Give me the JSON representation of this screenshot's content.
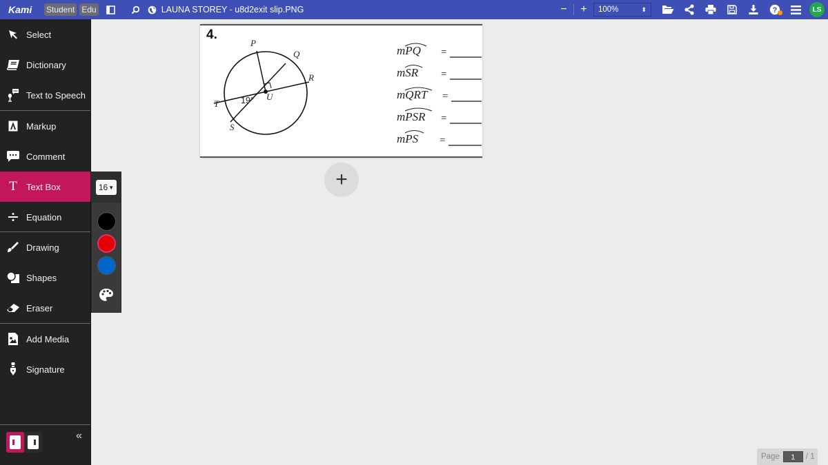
{
  "app": {
    "logo": "Kami",
    "badges": [
      "Student",
      "Edu"
    ],
    "doc_title": "LAUNA STOREY - u8d2exit slip.PNG"
  },
  "toolbar": {
    "zoom_out": "−",
    "zoom_in": "+",
    "zoom_level": "100%",
    "icons": [
      "open-folder-icon",
      "share-icon",
      "print-icon",
      "save-icon",
      "download-icon",
      "help-icon",
      "menu-icon"
    ],
    "user_initials": "LS",
    "notification_dot_color": "#ff9800"
  },
  "sidebar": {
    "items": [
      {
        "label": "Select",
        "icon": "cursor-arrow-icon"
      },
      {
        "label": "Dictionary",
        "icon": "book-icon"
      },
      {
        "label": "Text to Speech",
        "icon": "microphone-speech-icon"
      },
      {
        "label": "Markup",
        "icon": "markup-icon"
      },
      {
        "label": "Comment",
        "icon": "comment-icon"
      },
      {
        "label": "Text Box",
        "icon": "text-t-icon",
        "active": true
      },
      {
        "label": "Equation",
        "icon": "divide-icon"
      },
      {
        "label": "Drawing",
        "icon": "brush-icon"
      },
      {
        "label": "Shapes",
        "icon": "shapes-icon"
      },
      {
        "label": "Eraser",
        "icon": "eraser-icon"
      },
      {
        "label": "Add Media",
        "icon": "image-file-icon"
      },
      {
        "label": "Signature",
        "icon": "pen-nib-icon"
      }
    ],
    "collapse_label": "«",
    "accent_color": "#c2185b"
  },
  "textbox_options": {
    "font_size": "16",
    "colors": [
      {
        "name": "black",
        "hex": "#000000"
      },
      {
        "name": "red",
        "hex": "#e50000",
        "selected": true
      },
      {
        "name": "blue",
        "hex": "#0066cc"
      }
    ]
  },
  "document": {
    "problem_number": "4.",
    "figure": {
      "points": [
        "P",
        "Q",
        "R",
        "T",
        "S",
        "U"
      ],
      "angle_label": "19°",
      "right_angle_at": "U"
    },
    "questions": [
      {
        "arc": "PQ",
        "prefix": "m",
        "equals": "="
      },
      {
        "arc": "SR",
        "prefix": "m",
        "equals": "="
      },
      {
        "arc": "QRT",
        "prefix": "m",
        "equals": "="
      },
      {
        "arc": "PSR",
        "prefix": "m",
        "equals": "="
      },
      {
        "arc": "PS",
        "prefix": "m",
        "equals": "="
      }
    ]
  },
  "add_page_label": "+",
  "pagination": {
    "label": "Page",
    "current": "1",
    "total": "/ 1"
  }
}
